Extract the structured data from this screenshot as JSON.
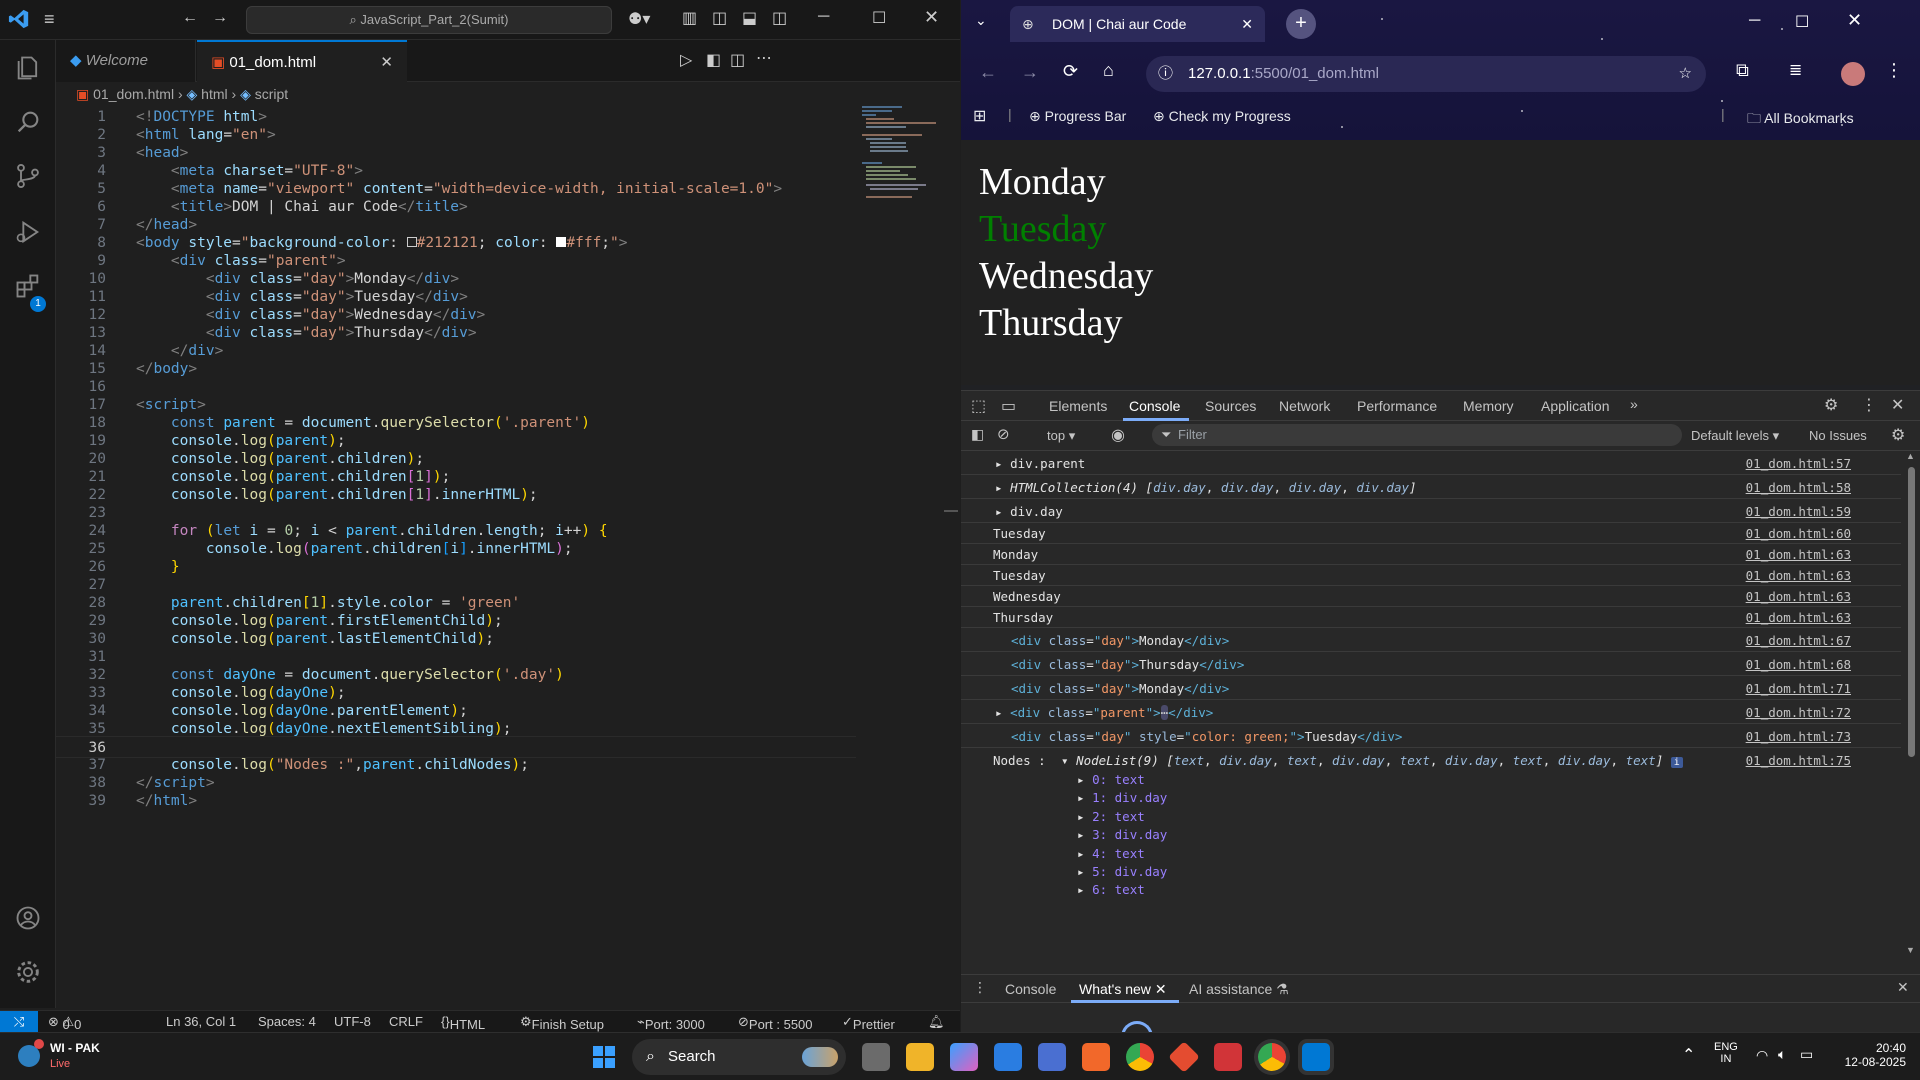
{
  "vscode": {
    "search_text": "JavaScript_Part_2(Sumit)",
    "tabs": [
      {
        "label": "Welcome"
      },
      {
        "label": "01_dom.html"
      }
    ],
    "breadcrumb": [
      "01_dom.html",
      "html",
      "script"
    ],
    "extensions_badge": "1",
    "status": {
      "errors": "0",
      "warnings": "0",
      "position": "Ln 36, Col 1",
      "spaces": "Spaces: 4",
      "encoding": "UTF-8",
      "eol": "CRLF",
      "language": "HTML",
      "finish_setup": "Finish Setup",
      "port1": "Port: 3000",
      "port2": "Port : 5500",
      "prettier": "Prettier"
    }
  },
  "chrome": {
    "tab_title": "DOM | Chai aur Code",
    "url_host": "127.0.0.1",
    "url_rest": ":5500/01_dom.html",
    "bookmarks": [
      "Progress Bar",
      "Check my Progress"
    ],
    "all_bookmarks": "All Bookmarks",
    "page_days": [
      {
        "text": "Monday",
        "color": "#ffffff"
      },
      {
        "text": "Tuesday",
        "color": "#008000"
      },
      {
        "text": "Wednesday",
        "color": "#ffffff"
      },
      {
        "text": "Thursday",
        "color": "#ffffff"
      }
    ],
    "devtools": {
      "tabs": [
        "Elements",
        "Console",
        "Sources",
        "Network",
        "Performance",
        "Memory",
        "Application"
      ],
      "active_tab": "Console",
      "context": "top",
      "filter_placeholder": "Filter",
      "levels": "Default levels",
      "issues": "No Issues",
      "drawer_tabs": [
        "Console",
        "What's new",
        "AI assistance"
      ]
    },
    "console_sources": {
      "l57": "01_dom.html:57",
      "l58": "01_dom.html:58",
      "l59": "01_dom.html:59",
      "l60": "01_dom.html:60",
      "l63": "01_dom.html:63",
      "l67": "01_dom.html:67",
      "l68": "01_dom.html:68",
      "l71": "01_dom.html:71",
      "l72": "01_dom.html:72",
      "l73": "01_dom.html:73",
      "l75": "01_dom.html:75"
    },
    "console_plain": [
      "Tuesday",
      "Monday",
      "Tuesday",
      "Wednesday",
      "Thursday"
    ],
    "nodes_label": "Nodes :",
    "nodelist_items": [
      "0: text",
      "1: div.day",
      "2: text",
      "3: div.day",
      "4: text",
      "5: div.day",
      "6: text"
    ]
  },
  "taskbar": {
    "weather_title": "WI - PAK",
    "weather_sub": "Live",
    "search": "Search",
    "lang1": "ENG",
    "lang2": "IN",
    "time": "20:40",
    "date": "12-08-2025"
  }
}
